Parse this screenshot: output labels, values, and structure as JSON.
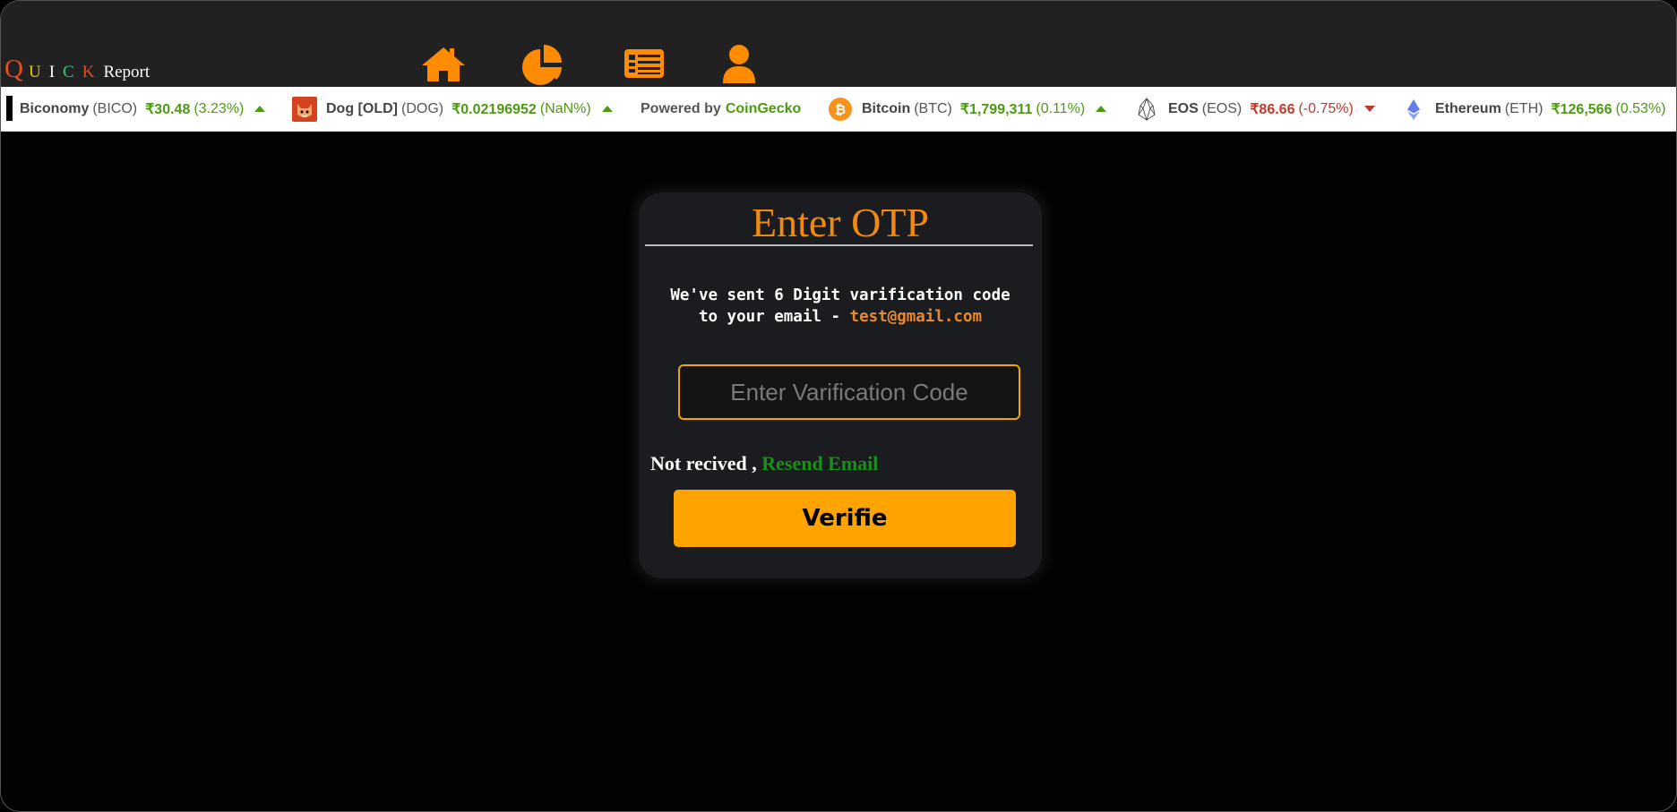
{
  "brand": {
    "letters": [
      {
        "char": "Q",
        "color": "#e74c1c"
      },
      {
        "char": "U",
        "color": "#f1c40f"
      },
      {
        "char": "I",
        "color": "#ffffff"
      },
      {
        "char": "C",
        "color": "#2ecc71"
      },
      {
        "char": "K",
        "color": "#e74c1c"
      }
    ],
    "suffix": "Report"
  },
  "nav": {
    "accent": "#ff8c00",
    "items": [
      "home-icon",
      "pie-chart-icon",
      "news-icon",
      "user-icon"
    ]
  },
  "ticker": {
    "coins": [
      {
        "name": "Biconomy",
        "symbol": "(BICO)",
        "price": "₹30.48",
        "change": "(3.23%)",
        "direction": "up"
      },
      {
        "name": "Dog [OLD]",
        "symbol": "(DOG)",
        "price": "₹0.02196952",
        "change": "(NaN%)",
        "direction": "up"
      },
      {
        "name": "Bitcoin",
        "symbol": "(BTC)",
        "price": "₹1,799,311",
        "change": "(0.11%)",
        "direction": "up"
      },
      {
        "name": "EOS",
        "symbol": "(EOS)",
        "price": "₹86.66",
        "change": "(-0.75%)",
        "direction": "down"
      },
      {
        "name": "Ethereum",
        "symbol": "(ETH)",
        "price": "₹126,566",
        "change": "(0.53%)",
        "direction": "up"
      }
    ],
    "powered_by": "Powered by",
    "powered_brand": "CoinGecko",
    "up_color": "#4c9a12",
    "down_color": "#c0392b"
  },
  "otp": {
    "title": "Enter OTP",
    "message_line1": "We've sent 6 Digit varification code",
    "message_line2": "to your email - ",
    "email": "test@gmail.com",
    "input_placeholder": "Enter Varification Code",
    "input_value": "",
    "not_received": "Not recived ,",
    "resend": "Resend Email",
    "verify_label": "Verifie"
  }
}
